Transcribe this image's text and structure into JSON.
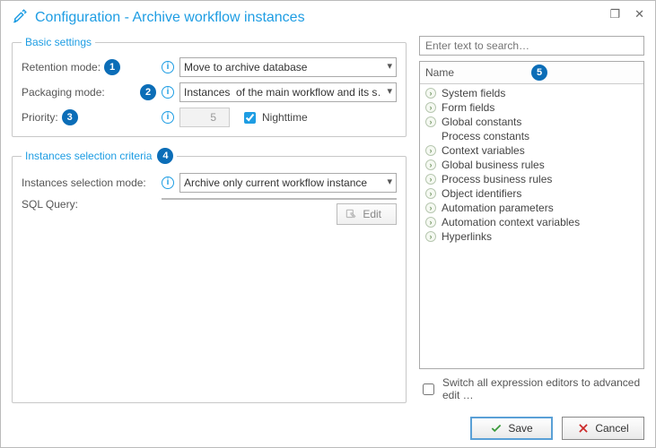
{
  "title": "Configuration - Archive workflow instances",
  "basic": {
    "legend": "Basic settings",
    "retention": {
      "label": "Retention mode:",
      "value": "Move to archive database"
    },
    "packaging": {
      "label": "Packaging mode:",
      "value": "Instances  of the main workflow and its s…"
    },
    "priority": {
      "label": "Priority:",
      "value": "5",
      "nighttime_label": "Nighttime"
    }
  },
  "criteria": {
    "legend": "Instances selection criteria",
    "mode": {
      "label": "Instances selection mode:",
      "value": "Archive only current workflow instance"
    },
    "sql_label": "SQL Query:",
    "edit_label": "Edit"
  },
  "search_placeholder": "Enter text to search…",
  "tree_header": "Name",
  "tree": [
    {
      "label": "System fields",
      "expandable": true
    },
    {
      "label": "Form fields",
      "expandable": true
    },
    {
      "label": "Global constants",
      "expandable": true
    },
    {
      "label": "Process constants",
      "expandable": false
    },
    {
      "label": "Context variables",
      "expandable": true
    },
    {
      "label": "Global business rules",
      "expandable": true
    },
    {
      "label": "Process business rules",
      "expandable": true
    },
    {
      "label": "Object identifiers",
      "expandable": true
    },
    {
      "label": "Automation parameters",
      "expandable": true
    },
    {
      "label": "Automation context variables",
      "expandable": true
    },
    {
      "label": "Hyperlinks",
      "expandable": true
    }
  ],
  "advanced_label": "Switch all expression editors to advanced edit …",
  "buttons": {
    "save": "Save",
    "cancel": "Cancel"
  },
  "badges": {
    "b1": "1",
    "b2": "2",
    "b3": "3",
    "b4": "4",
    "b5": "5"
  }
}
